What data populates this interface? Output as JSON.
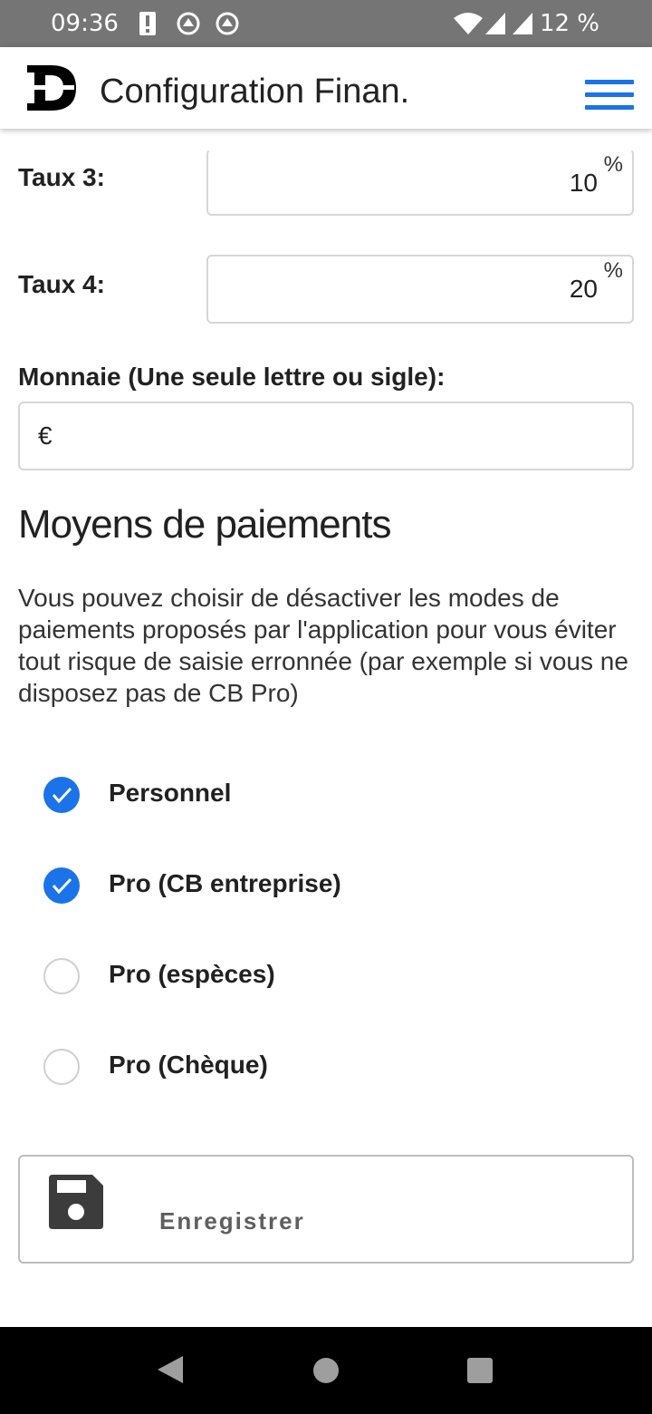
{
  "status_bar": {
    "time": "09:36",
    "battery": "12 %",
    "icons": [
      "alert-icon",
      "sync-icon",
      "sync-icon",
      "wifi-icon",
      "signal-icon",
      "signal-icon"
    ]
  },
  "header": {
    "title": "Configuration Finan.",
    "logo": "D-logo",
    "menu_icon": "hamburger-icon"
  },
  "form": {
    "rate3": {
      "label": "Taux 3:",
      "value": "10",
      "unit": "%"
    },
    "rate4": {
      "label": "Taux 4:",
      "value": "20",
      "unit": "%"
    },
    "currency": {
      "label": "Monnaie (Une seule lettre ou sigle):",
      "value": "€"
    }
  },
  "payments": {
    "title": "Moyens de paiements",
    "description": "Vous pouvez choisir de désactiver les modes de paiements proposés par l'application pour vous éviter tout risque de saisie erronnée (par exemple si vous ne disposez pas de CB Pro)",
    "options": [
      {
        "label": "Personnel",
        "checked": true
      },
      {
        "label": "Pro (CB entreprise)",
        "checked": true
      },
      {
        "label": "Pro (espèces)",
        "checked": false
      },
      {
        "label": "Pro (Chèque)",
        "checked": false
      }
    ]
  },
  "save_button": {
    "label": "Enregistrer",
    "icon": "floppy-disk-icon"
  },
  "colors": {
    "accent": "#1a73e8",
    "status_bar": "#757575",
    "nav_bar": "#000000"
  }
}
